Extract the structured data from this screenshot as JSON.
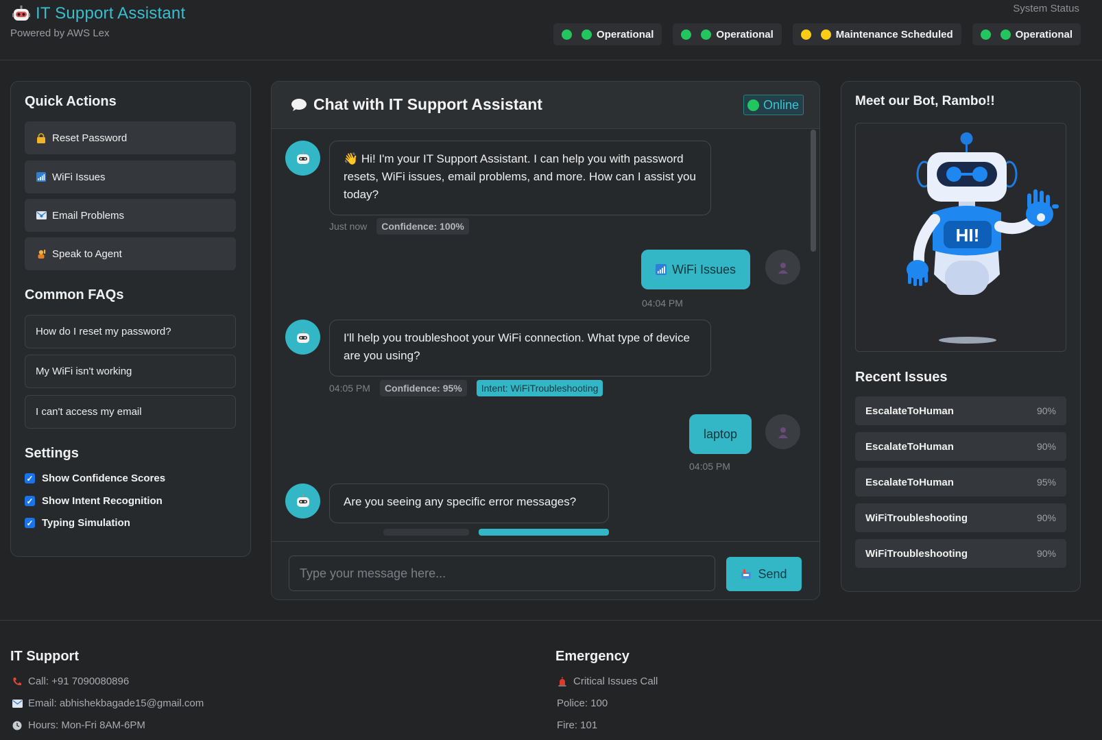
{
  "header": {
    "title": "IT Support Assistant",
    "subtitle": "Powered by AWS Lex",
    "status_label": "System Status",
    "statuses": [
      {
        "label": "Operational",
        "color": "#22c55e"
      },
      {
        "label": "Operational",
        "color": "#22c55e"
      },
      {
        "label": "Maintenance Scheduled",
        "color": "#facc15"
      },
      {
        "label": "Operational",
        "color": "#22c55e"
      }
    ]
  },
  "left": {
    "quick_actions_title": "Quick Actions",
    "quick_actions": [
      {
        "label": "Reset Password",
        "icon": "lock-icon"
      },
      {
        "label": "WiFi Issues",
        "icon": "signal-bars-icon"
      },
      {
        "label": "Email Problems",
        "icon": "email-icon"
      },
      {
        "label": "Speak to Agent",
        "icon": "raised-hand-icon"
      }
    ],
    "faqs_title": "Common FAQs",
    "faqs": [
      "How do I reset my password?",
      "My WiFi isn't working",
      "I can't access my email"
    ],
    "settings_title": "Settings",
    "settings": [
      {
        "label": "Show Confidence Scores",
        "checked": true
      },
      {
        "label": "Show Intent Recognition",
        "checked": true
      },
      {
        "label": "Typing Simulation",
        "checked": true
      }
    ]
  },
  "chat": {
    "title": "Chat with IT Support Assistant",
    "status": "Online",
    "messages": [
      {
        "from": "bot",
        "text": "👋 Hi! I'm your IT Support Assistant. I can help you with password resets, WiFi issues, email problems, and more. How can I assist you today?",
        "time": "Just now",
        "confidence": "Confidence: 100%"
      },
      {
        "from": "user",
        "text": "WiFi Issues",
        "time": "04:04 PM"
      },
      {
        "from": "bot",
        "text": "I'll help you troubleshoot your WiFi connection. What type of device are you using?",
        "time": "04:05 PM",
        "confidence": "Confidence: 95%",
        "intent": "Intent: WiFiTroubleshooting"
      },
      {
        "from": "user",
        "text": "laptop",
        "time": "04:05 PM"
      },
      {
        "from": "bot",
        "text": "Are you seeing any specific error messages?"
      }
    ],
    "input_placeholder": "Type your message here...",
    "send_label": "Send"
  },
  "right": {
    "bot_title": "Meet our Bot, Rambo!!",
    "bot_badge": "HI!",
    "recent_title": "Recent Issues",
    "recent": [
      {
        "name": "EscalateToHuman",
        "pct": "90%"
      },
      {
        "name": "EscalateToHuman",
        "pct": "90%"
      },
      {
        "name": "EscalateToHuman",
        "pct": "95%"
      },
      {
        "name": "WiFiTroubleshooting",
        "pct": "90%"
      },
      {
        "name": "WiFiTroubleshooting",
        "pct": "90%"
      }
    ]
  },
  "footer": {
    "support_title": "IT Support",
    "support_lines": [
      "Call: +91 7090080896",
      "Email: abhishekbagade15@gmail.com",
      "Hours: Mon-Fri 8AM-6PM"
    ],
    "emergency_title": "Emergency",
    "emergency_lines": [
      "Critical Issues Call",
      "Police: 100",
      "Fire: 101"
    ]
  },
  "colors": {
    "accent": "#33b7c7",
    "background": "#222426",
    "panel": "#272a2d"
  }
}
